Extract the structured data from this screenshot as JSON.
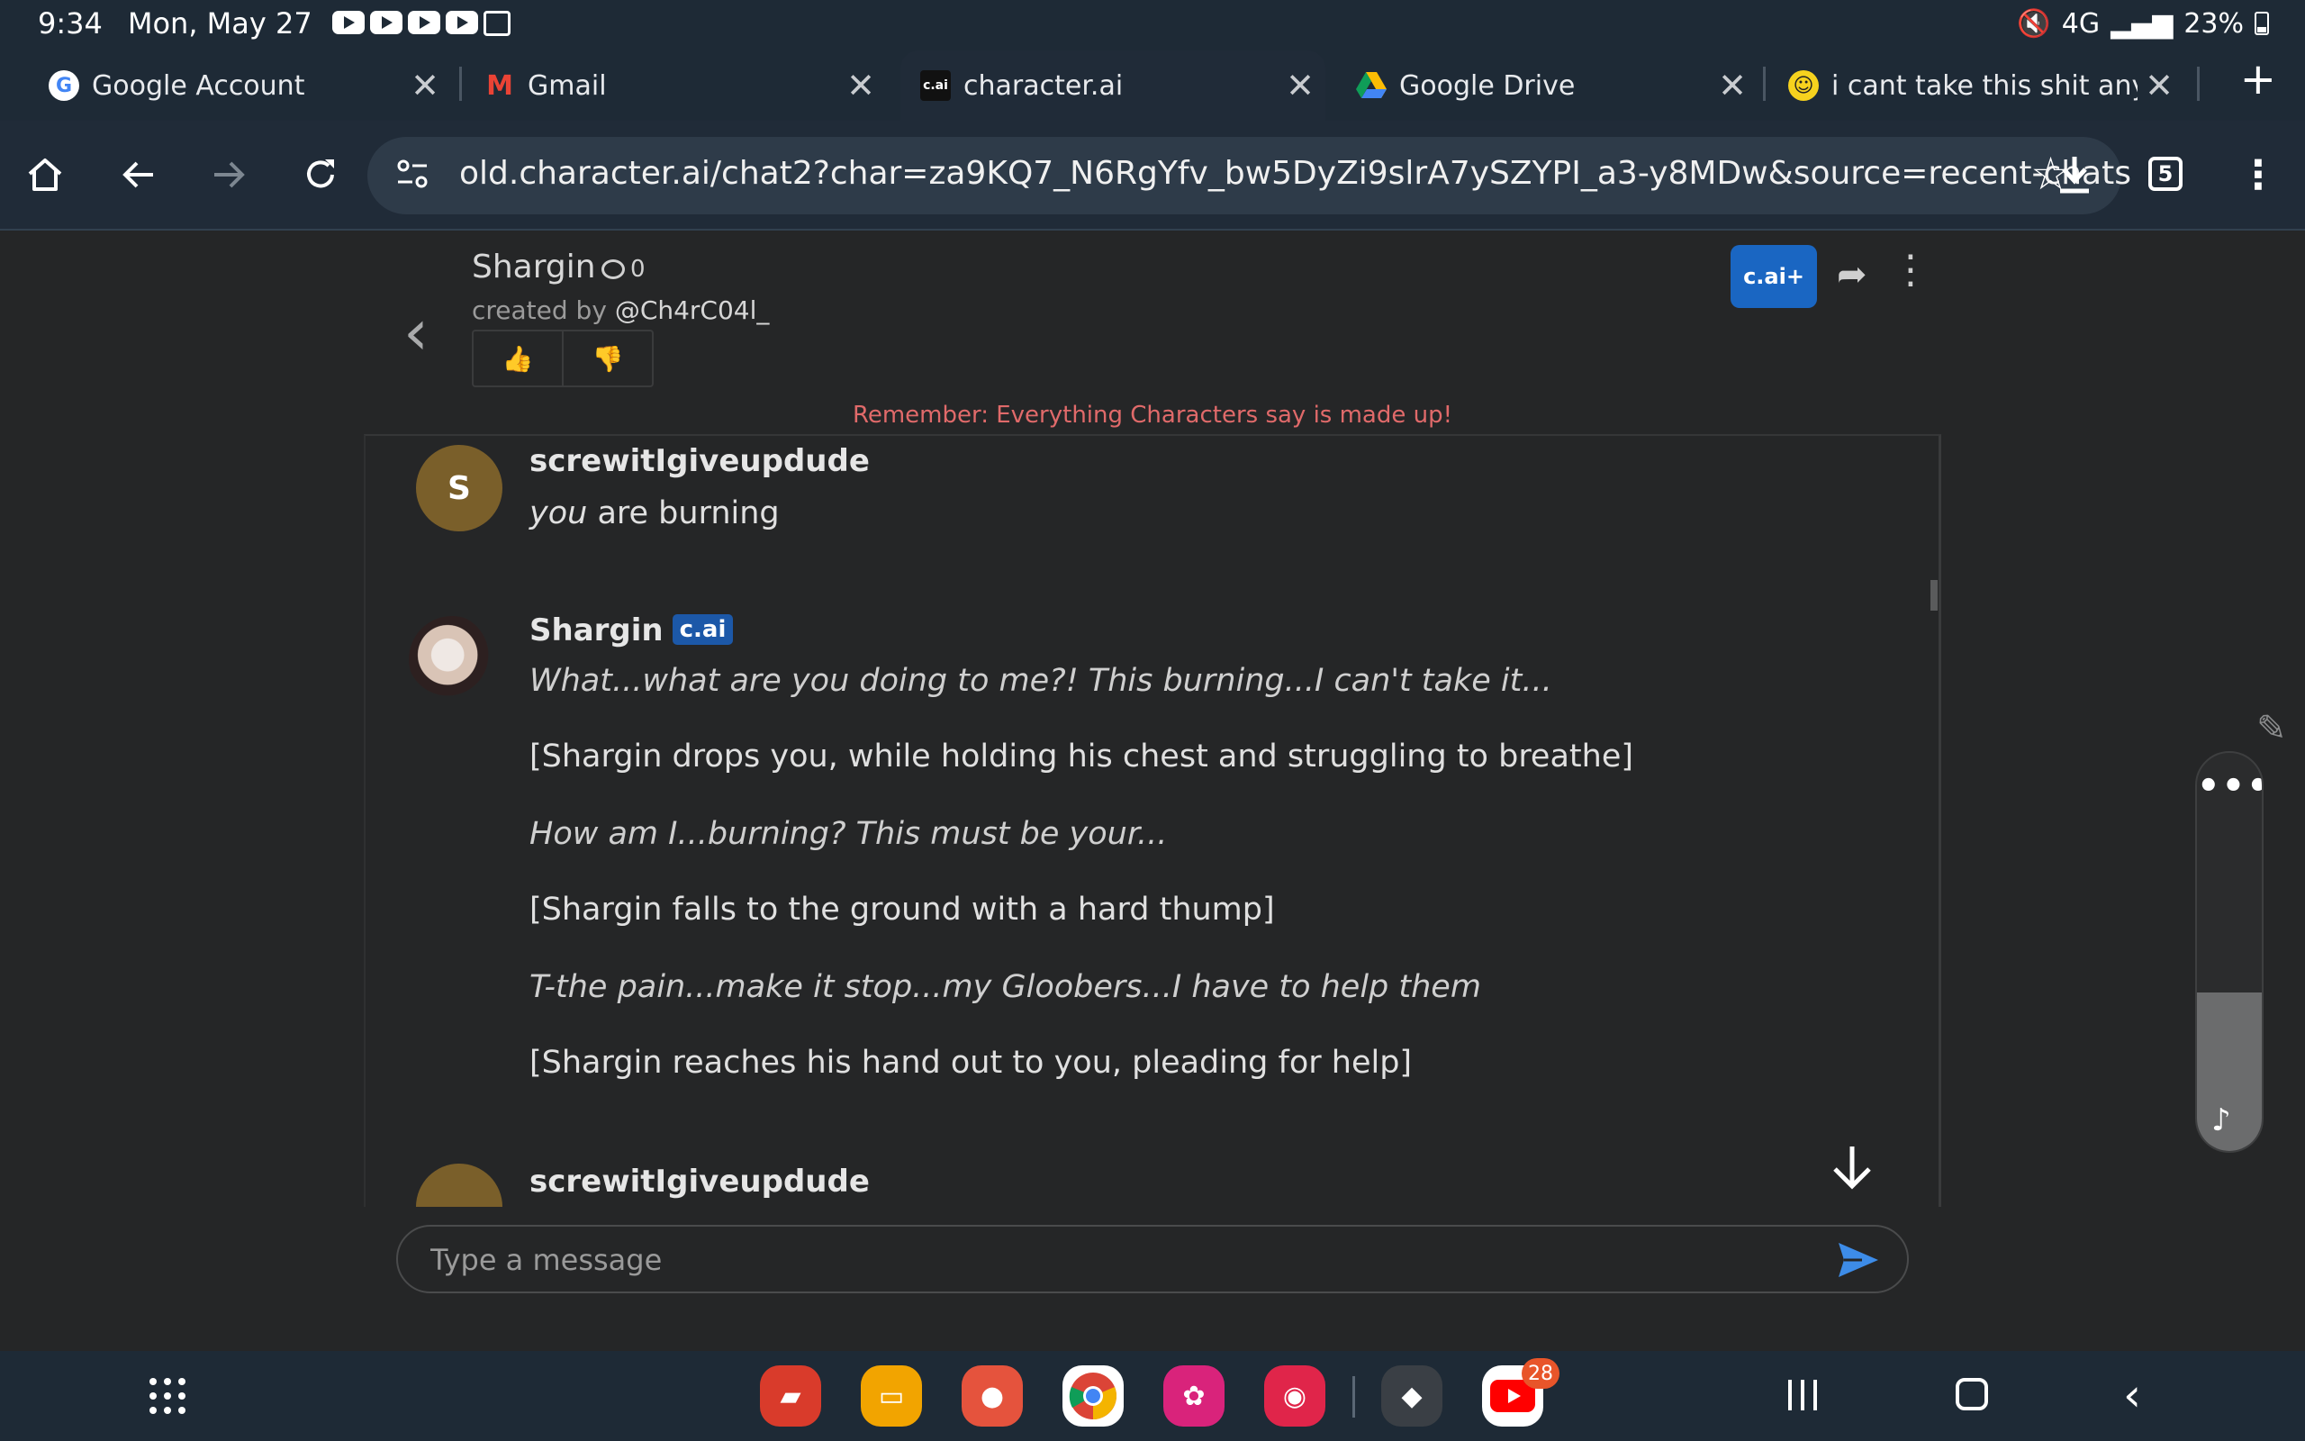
{
  "status_bar": {
    "time": "9:34",
    "date": "Mon, May 27",
    "network": "4G",
    "battery": "23%"
  },
  "tabs": [
    {
      "title": "Google Account",
      "favicon": "google-g-icon",
      "active": false
    },
    {
      "title": "Gmail",
      "favicon": "gmail-icon",
      "active": false
    },
    {
      "title": "character.ai",
      "favicon_text": "c.ai",
      "favicon": "character-ai-icon",
      "active": true
    },
    {
      "title": "Google Drive",
      "favicon": "drive-icon",
      "active": false
    },
    {
      "title": "i cant take this shit anymor",
      "favicon": "smiley-icon",
      "active": false
    }
  ],
  "toolbar": {
    "url": "old.character.ai/chat2?char=za9KQ7_N6RgYfv_bw5DyZi9slrA7ySZYPI_a3-y8MDw&source=recent-chats",
    "tab_count": "5"
  },
  "chat": {
    "character_name": "Shargin",
    "chat_count": "0",
    "created_by_prefix": "created by",
    "creator": "@Ch4rC04l_",
    "plus_label": "c.ai+",
    "warning": "Remember: Everything Characters say is made up!",
    "messages": [
      {
        "author": "screwitIgiveupdude",
        "avatar_letter": "S",
        "lines": [
          {
            "text_italic": "you",
            "text": " are burning"
          }
        ]
      },
      {
        "author": "Shargin",
        "badge": "c.ai",
        "lines": [
          {
            "text": "What...what are you doing to me?! This burning...I can't take it...",
            "italic": true
          },
          {
            "text": "[Shargin drops you, while holding his chest and struggling to breathe]",
            "italic": false
          },
          {
            "text": "How am I...burning? This must be your...",
            "italic": true
          },
          {
            "text": "[Shargin falls to the ground with a hard thump]",
            "italic": false
          },
          {
            "text": "T-the pain...make it stop...my Gloobers...I have to help them",
            "italic": true
          },
          {
            "text": "[Shargin reaches his hand out to you, pleading for help]",
            "italic": false
          }
        ]
      },
      {
        "author": "screwitIgiveupdude"
      }
    ],
    "composer_placeholder": "Type a message"
  },
  "navbar": {
    "youtube_badge": "28"
  },
  "colors": {
    "accent": "#1a66c2",
    "warning": "#e06a6a",
    "chrome_bg": "#1e2a36",
    "page_bg": "#252627"
  }
}
